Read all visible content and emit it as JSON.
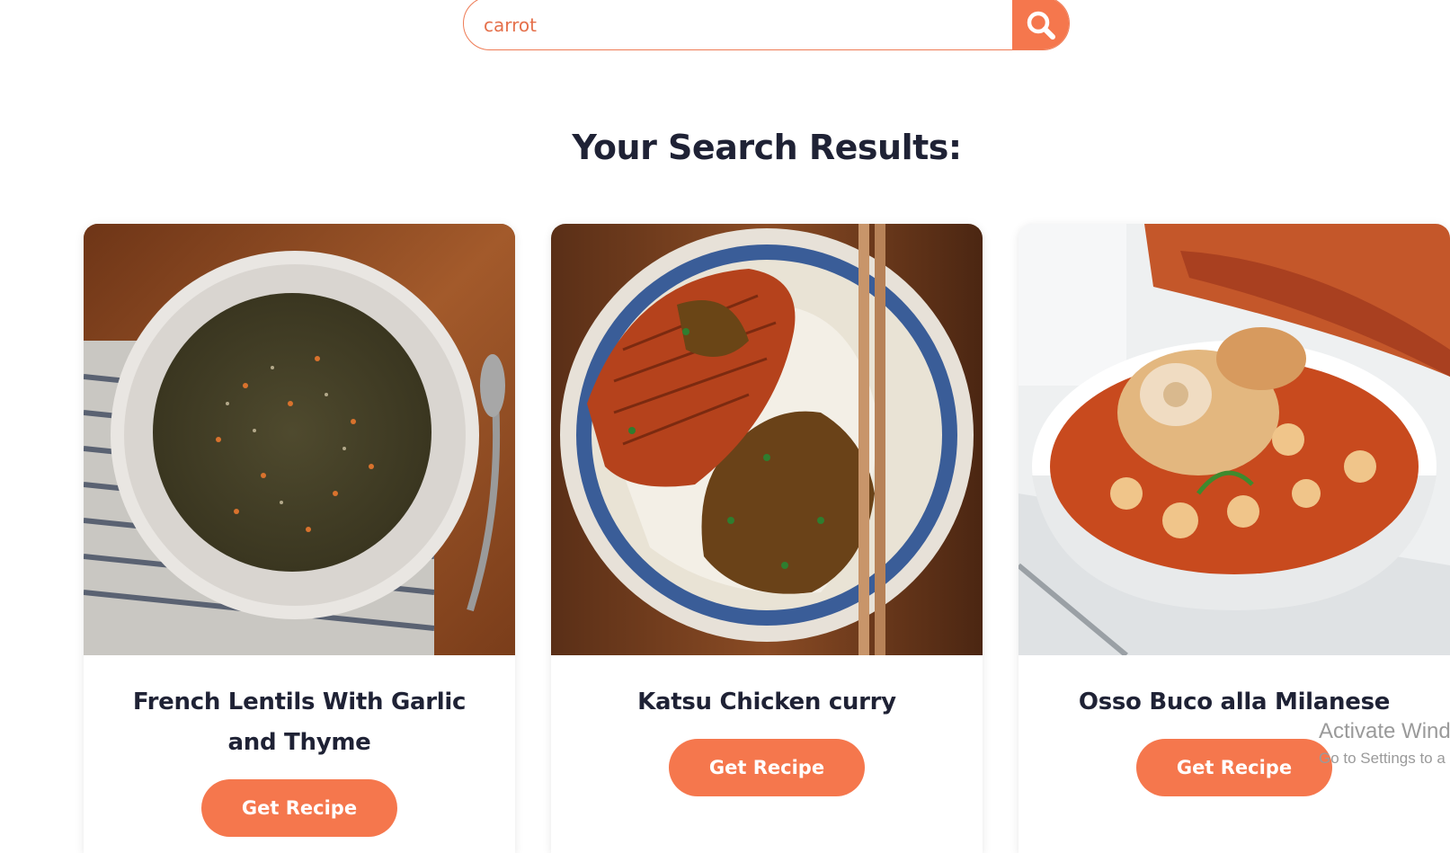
{
  "search": {
    "value": "carrot",
    "placeholder": "",
    "button_icon": "search-icon"
  },
  "results": {
    "title": "Your Search Results:"
  },
  "recipes": [
    {
      "title": "French Lentils With Garlic and Thyme",
      "button_label": "Get Recipe",
      "image": "lentils-bowl-image"
    },
    {
      "title": "Katsu Chicken curry",
      "button_label": "Get Recipe",
      "image": "katsu-curry-image"
    },
    {
      "title": "Osso Buco alla Milanese",
      "button_label": "Get Recipe",
      "image": "osso-buco-image"
    }
  ],
  "watermark": {
    "line1": "Activate Wind",
    "line2": "Go to Settings to a"
  },
  "colors": {
    "accent": "#f5774d",
    "heading": "#1f2235",
    "background": "#ffffff"
  }
}
